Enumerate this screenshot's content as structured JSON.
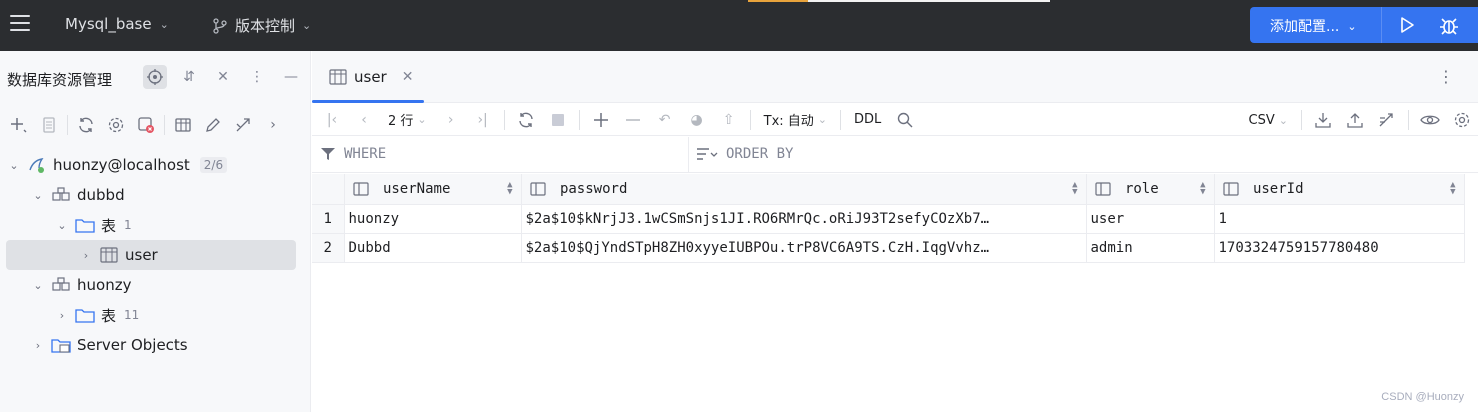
{
  "topbar": {
    "menu_icon": "hamburger-icon",
    "project_name": "Mysql_base",
    "vcs_label": "版本控制",
    "run_config_label": "添加配置...",
    "accent_color": "#3574f0"
  },
  "left_panel": {
    "title": "数据库资源管理",
    "tree": {
      "connection": {
        "label": "huonzy@localhost",
        "badge": "2/6"
      },
      "schema1": {
        "label": "dubbd"
      },
      "tables1": {
        "label": "表",
        "count": "1"
      },
      "table_user": {
        "label": "user"
      },
      "schema2": {
        "label": "huonzy"
      },
      "tables2": {
        "label": "表",
        "count": "11"
      },
      "server_objects": {
        "label": "Server Objects"
      }
    }
  },
  "editor": {
    "tab_label": "user",
    "toolbar": {
      "rows_label": "2 行",
      "tx_label": "Tx: 自动",
      "ddl_label": "DDL",
      "export_format": "CSV"
    },
    "filter": {
      "where_placeholder": "WHERE",
      "order_placeholder": "ORDER BY"
    },
    "columns": [
      "userName",
      "password",
      "role",
      "userId"
    ],
    "rows": [
      {
        "num": "1",
        "userName": "huonzy",
        "password": "$2a$10$kNrjJ3.1wCSmSnjs1JI.RO6RMrQc.oRiJ93T2sefyCOzXb7…",
        "role": "user",
        "userId": "1"
      },
      {
        "num": "2",
        "userName": "Dubbd",
        "password": "$2a$10$QjYndSTpH8ZH0xyyeIUBPOu.trP8VC6A9TS.CzH.IqgVvhz…",
        "role": "admin",
        "userId": "1703324759157780480"
      }
    ]
  },
  "watermark": "CSDN @Huonzy"
}
